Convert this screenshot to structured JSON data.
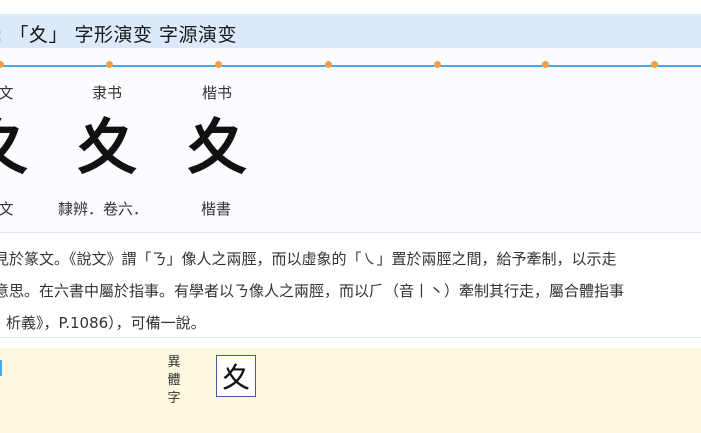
{
  "header": {
    "title": ": 「夊」 字形演变 字源演变"
  },
  "timeline": {
    "stages": [
      {
        "name": "文",
        "glyph": "夊",
        "source": "文"
      },
      {
        "name": "隶书",
        "glyph": "夊",
        "source": "隸辨．卷六．"
      },
      {
        "name": "楷书",
        "glyph": "夊",
        "source": "楷書"
      }
    ]
  },
  "description": {
    "lines": [
      "見於篆文。《說文》謂「ㄋ」像人之兩脛，而以虛象的「㇏」置於兩脛之間，給予牽制，以示走",
      "意思。在六書中屬於指事。有學者以ㄋ像人之兩脛，而以⺁（音丨丶）牽制其行走，屬合體指事",
      "析義》，P.1086），可備一說。"
    ]
  },
  "variant": {
    "label_chars": [
      "異",
      "體",
      "字"
    ],
    "glyph": "夊"
  }
}
